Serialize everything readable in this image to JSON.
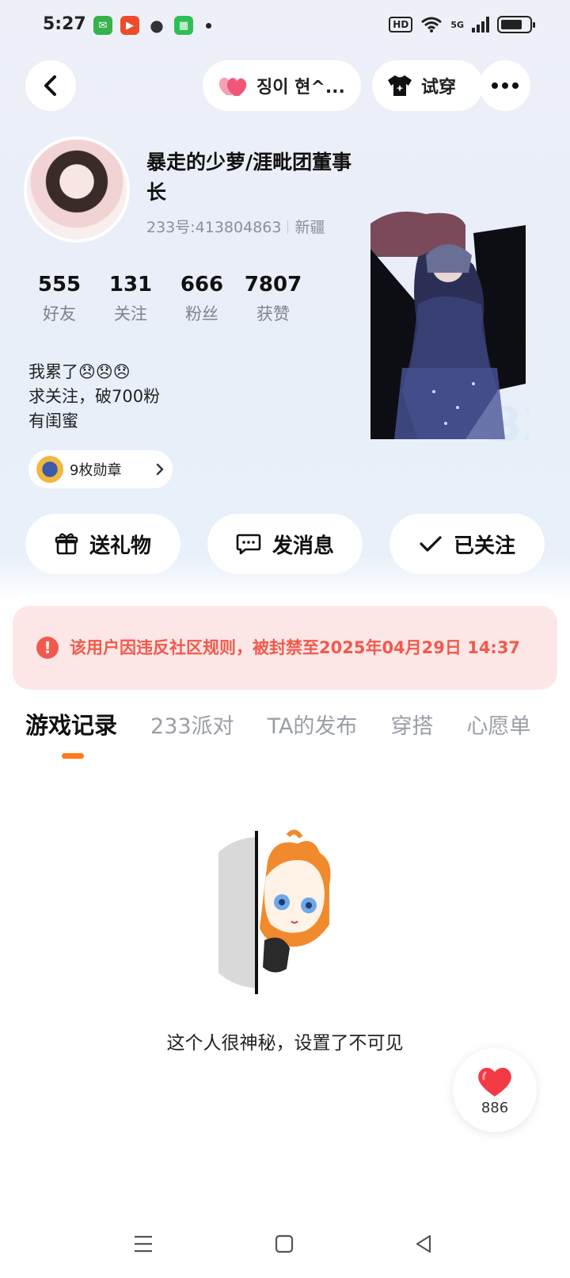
{
  "status_bar": {
    "time": "5:27",
    "hd_label": "HD",
    "network_label": "5G",
    "notification_icons": [
      "messages-icon",
      "video-app-icon",
      "wechat-icon",
      "store-icon"
    ]
  },
  "header": {
    "intimacy_name": "징이 현^...",
    "try_on_label": "试穿"
  },
  "profile": {
    "nickname": "暴走的少萝/涯毗团董事长",
    "uid": "233号:413804863",
    "location": "新疆",
    "stats": [
      {
        "value": "555",
        "label": "好友"
      },
      {
        "value": "131",
        "label": "关注"
      },
      {
        "value": "666",
        "label": "粉丝"
      },
      {
        "value": "7807",
        "label": "获赞"
      }
    ],
    "bio": [
      "我累了😞😞😞",
      "求关注，破700粉",
      "有闺蜜"
    ],
    "medals_label": "9枚勋章"
  },
  "actions": {
    "gift_label": "送礼物",
    "message_label": "发消息",
    "follow_label": "已关注"
  },
  "ban_notice": {
    "text": "该用户因违反社区规则，被封禁至2025年04月29日 14:37"
  },
  "tabs": [
    {
      "label": "游戏记录",
      "active": true
    },
    {
      "label": "233派对",
      "active": false
    },
    {
      "label": "TA的发布",
      "active": false
    },
    {
      "label": "穿搭",
      "active": false
    },
    {
      "label": "心愿单",
      "active": false
    }
  ],
  "empty_state": {
    "text": "这个人很神秘，设置了不可见"
  },
  "like": {
    "count": "886"
  },
  "colors": {
    "accent_orange": "#ff7a1a",
    "ban_red": "#f05a4d",
    "ban_bg": "#fde7e6",
    "heart_pink": "#f2557a"
  }
}
